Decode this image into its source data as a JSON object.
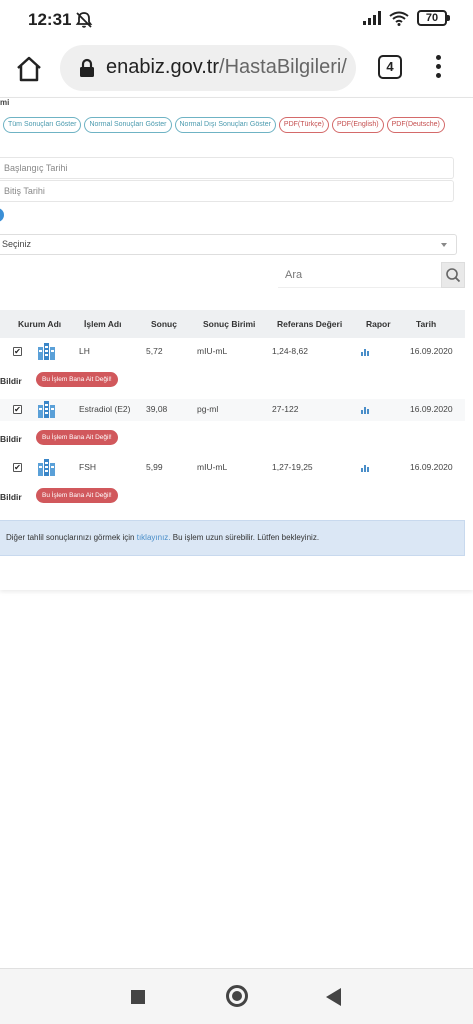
{
  "status_bar": {
    "time": "12:31",
    "battery": "70",
    "icons": [
      "mute-icon",
      "signal-icon",
      "wifi-icon",
      "battery-icon"
    ]
  },
  "browser": {
    "domain": "enabiz.gov.tr",
    "path": "/HastaBilgileri/",
    "tab_count": "4",
    "icons": [
      "home-icon",
      "lock-icon",
      "menu-icon"
    ]
  },
  "page": {
    "partial_label": "mi",
    "filters": [
      {
        "label": "Tüm Sonuçları Göster",
        "style": "teal"
      },
      {
        "label": "Normal Sonuçları Göster",
        "style": "teal"
      },
      {
        "label": "Normal Dışı Sonuçları Göster",
        "style": "teal"
      },
      {
        "label": "PDF(Türkçe)",
        "style": "red"
      },
      {
        "label": "PDF(English)",
        "style": "red"
      },
      {
        "label": "PDF(Deutsche)",
        "style": "red"
      }
    ],
    "start_date_placeholder": "Başlangıç Tarihi",
    "end_date_placeholder": "Bitiş Tarihi",
    "select_value": "Seçiniz",
    "search_placeholder": "Ara",
    "table": {
      "headers": [
        "Kurum Adı",
        "İşlem Adı",
        "Sonuç",
        "Sonuç Birimi",
        "Referans Değeri",
        "Rapor",
        "Tarih"
      ],
      "rows": [
        {
          "checked": true,
          "test": "LH",
          "result": "5,72",
          "unit": "mIU-mL",
          "reference": "1,24-8,62",
          "date": "16.09.2020"
        },
        {
          "checked": true,
          "test": "Estradiol (E2)",
          "result": "39,08",
          "unit": "pg-ml",
          "reference": "27-122",
          "date": "16.09.2020"
        },
        {
          "checked": true,
          "test": "FSH",
          "result": "5,99",
          "unit": "mIU-mL",
          "reference": "1,27-19,25",
          "date": "16.09.2020"
        }
      ],
      "report_label": "Bildir",
      "not_mine_button": "Bu İşlem Bana Ait Değil!"
    },
    "info": {
      "prefix": "Diğer tahlil sonuçlarınızı görmek için ",
      "link": "tıklayınız.",
      "suffix": " Bu işlem uzun sürebilir. Lütfen bekleyiniz."
    },
    "colors": {
      "teal_pill": "#4a9aae",
      "red_pill": "#c44d4d",
      "not_mine_bg": "#d1585c",
      "info_bg": "#dbe7f5",
      "link": "#4a8ec9"
    }
  },
  "nav_bar": {
    "icons": [
      "recents-icon",
      "home-circle-icon",
      "back-icon"
    ]
  }
}
